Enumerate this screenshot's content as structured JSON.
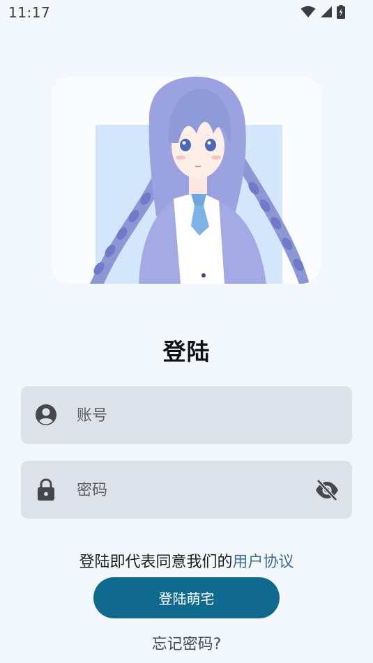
{
  "status_bar": {
    "time": "11:17",
    "icons": [
      "wifi-icon",
      "signal-icon",
      "battery-charging-icon"
    ]
  },
  "hero": {
    "image": "anime-girl-illustration"
  },
  "title": "登陆",
  "account_field": {
    "placeholder": "账号",
    "value": "",
    "icon": "account-circle-icon"
  },
  "password_field": {
    "placeholder": "密码",
    "value": "",
    "icon": "lock-icon",
    "toggle_icon": "visibility-off-icon"
  },
  "agreement": {
    "text": "登陆即代表同意我们的",
    "link": "用户协议"
  },
  "login_button": "登陆萌宅",
  "forgot_password": "忘记密码?",
  "colors": {
    "background": "#f3f8fd",
    "field_bg": "#dde2ea",
    "primary": "#106a8f",
    "link": "#3d6e8f"
  }
}
